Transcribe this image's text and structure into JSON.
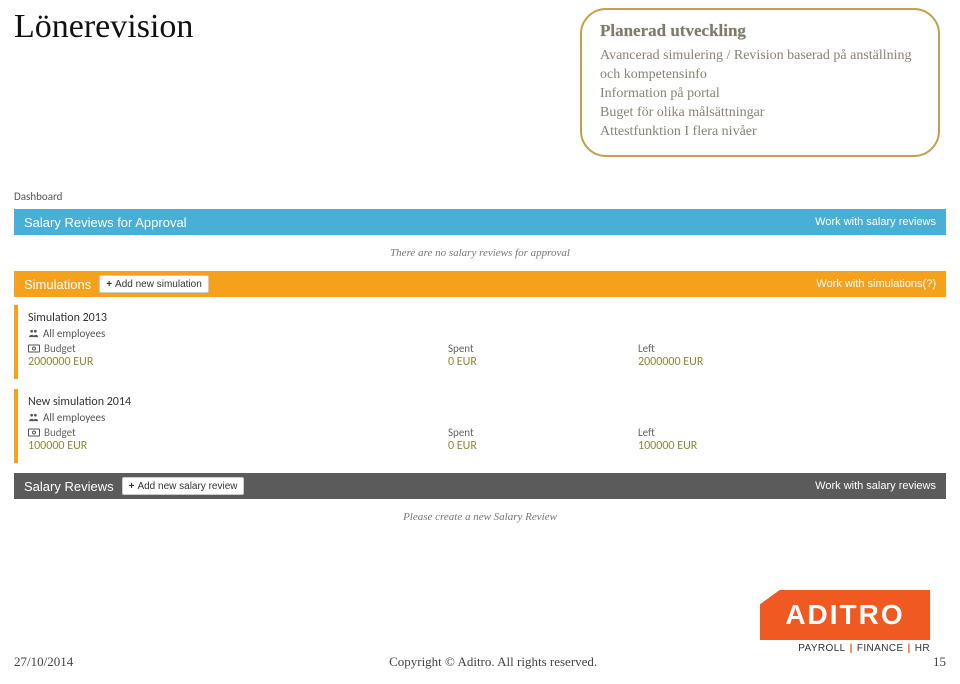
{
  "page": {
    "title": "Lönerevision"
  },
  "callout": {
    "heading": "Planerad utveckling",
    "lines": [
      "Avancerad simulering / Revision baserad på anställning och kompetensinfo",
      "Information på portal",
      "Buget för olika målsättningar",
      "Attestfunktion I flera nivåer"
    ]
  },
  "dashboard": {
    "label": "Dashboard",
    "approval_bar": {
      "title": "Salary Reviews for Approval",
      "link": "Work with salary reviews",
      "message": "There are no salary reviews for approval"
    },
    "simulations_bar": {
      "title": "Simulations",
      "add_label": "Add new simulation",
      "link": "Work with simulations(?)"
    },
    "simulations": [
      {
        "title": "Simulation 2013",
        "scope": "All employees",
        "budget_label": "Budget",
        "budget_value": "2000000 EUR",
        "spent_label": "Spent",
        "spent_value": "0 EUR",
        "left_label": "Left",
        "left_value": "2000000 EUR"
      },
      {
        "title": "New simulation 2014",
        "scope": "All employees",
        "budget_label": "Budget",
        "budget_value": "100000 EUR",
        "spent_label": "Spent",
        "spent_value": "0 EUR",
        "left_label": "Left",
        "left_value": "100000 EUR"
      }
    ],
    "reviews_bar": {
      "title": "Salary Reviews",
      "add_label": "Add new salary review",
      "link": "Work with salary reviews",
      "message": "Please create a new Salary Review"
    }
  },
  "footer": {
    "date": "27/10/2014",
    "copyright": "Copyright © Aditro. All rights reserved.",
    "page": "15"
  },
  "logo": {
    "brand": "ADITRO",
    "sub1": "PAYROLL",
    "sub2": "FINANCE",
    "sub3": "HR"
  }
}
